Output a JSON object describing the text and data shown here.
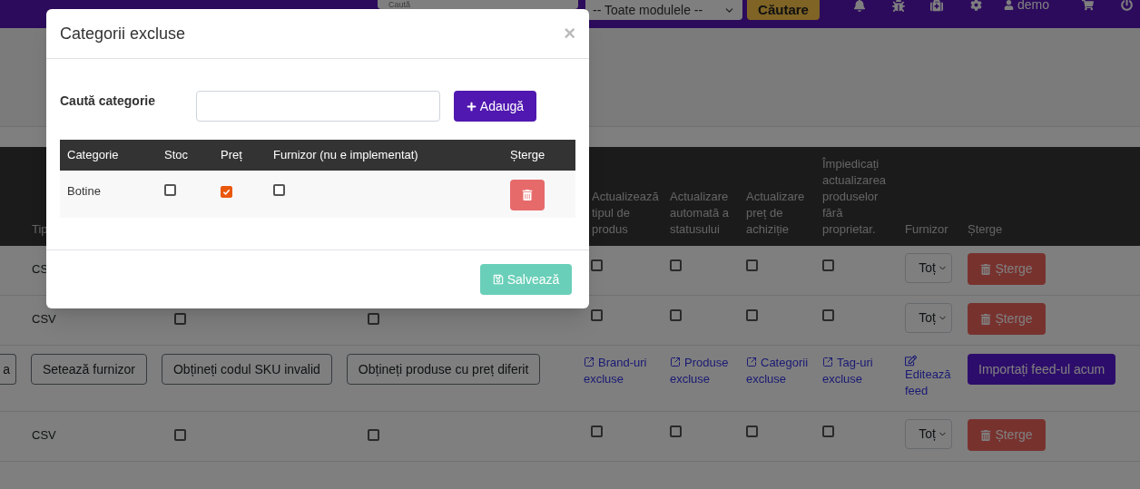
{
  "top_bar": {
    "search": {
      "placeholder": "Caută"
    },
    "module_select": "-- Toate modulele --",
    "search_button": "Căutare",
    "user": "demo"
  },
  "feeds_table": {
    "columns": [
      "Tip",
      "Actualizează tipul de produs",
      "Actualizare automată a statusului",
      "Actualizare preț de achiziție",
      "Împiedicați actualizarea produselor fără proprietar.",
      "Furnizor",
      "Șterge"
    ],
    "rows": [
      {
        "kind": "feed",
        "type": "CS",
        "left_checks": [],
        "right_checks": [
          {
            "checked": false
          },
          {
            "checked": false
          },
          {
            "checked": false
          },
          {
            "checked": false
          }
        ],
        "supplier": "Toț",
        "delete": "Șterge"
      },
      {
        "kind": "feed",
        "type": "CSV",
        "left_checks": [
          {
            "checked": false
          },
          {
            "checked": false
          }
        ],
        "right_checks": [
          {
            "checked": false
          },
          {
            "checked": false
          },
          {
            "checked": false
          },
          {
            "checked": false
          }
        ],
        "supplier": "Toț",
        "delete": "Șterge"
      },
      {
        "kind": "actions",
        "buttons": [
          "a",
          "Setează furnizor",
          "Obțineți codul SKU invalid",
          "Obțineți produse cu preț diferit"
        ],
        "links": [
          "Brand-uri excluse",
          "Produse excluse",
          "Categorii excluse",
          "Tag-uri excluse"
        ],
        "edit_link": "Editează feed",
        "import_button": "Importați feed-ul acum"
      },
      {
        "kind": "feed",
        "type": "CSV",
        "left_checks": [
          {
            "checked": false
          },
          {
            "checked": false
          }
        ],
        "right_checks": [
          {
            "checked": false
          },
          {
            "checked": false
          },
          {
            "checked": false
          },
          {
            "checked": false
          }
        ],
        "supplier": "Toț",
        "delete": "Șterge"
      }
    ]
  },
  "modal": {
    "title": "Categorii excluse",
    "close": "×",
    "search_label": "Caută categorie",
    "add_button": "Adaugă",
    "table": {
      "columns": [
        "Categorie",
        "Stoc",
        "Preț",
        "Furnizor (nu e implementat)",
        "Șterge"
      ],
      "rows": [
        {
          "category": "Botine",
          "stock": {
            "checked": false
          },
          "price": {
            "checked": true
          },
          "supplier": {
            "checked": false
          }
        }
      ]
    },
    "save_button": "Salvează"
  }
}
